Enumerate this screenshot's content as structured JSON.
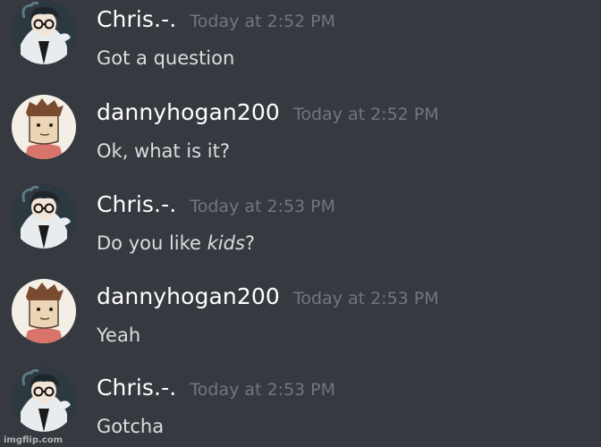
{
  "messages": [
    {
      "username": "Chris.-.",
      "timestamp": "Today at 2:52 PM",
      "content": "Got a question",
      "avatar": "chris-avatar"
    },
    {
      "username": "dannyhogan200",
      "timestamp": "Today at 2:52 PM",
      "content": "Ok, what is it?",
      "avatar": "danny-avatar"
    },
    {
      "username": "Chris.-.",
      "timestamp": "Today at 2:53 PM",
      "content_prefix": "Do you like ",
      "content_italic": "kids",
      "content_suffix": "?",
      "avatar": "chris-avatar"
    },
    {
      "username": "dannyhogan200",
      "timestamp": "Today at 2:53 PM",
      "content": "Yeah",
      "avatar": "danny-avatar"
    },
    {
      "username": "Chris.-.",
      "timestamp": "Today at 2:53 PM",
      "content": "Gotcha",
      "avatar": "chris-avatar"
    }
  ],
  "watermark": "imgflip.com",
  "colors": {
    "background": "#36393f",
    "username": "#ffffff",
    "timestamp": "#72767d",
    "text": "#dcddde"
  }
}
